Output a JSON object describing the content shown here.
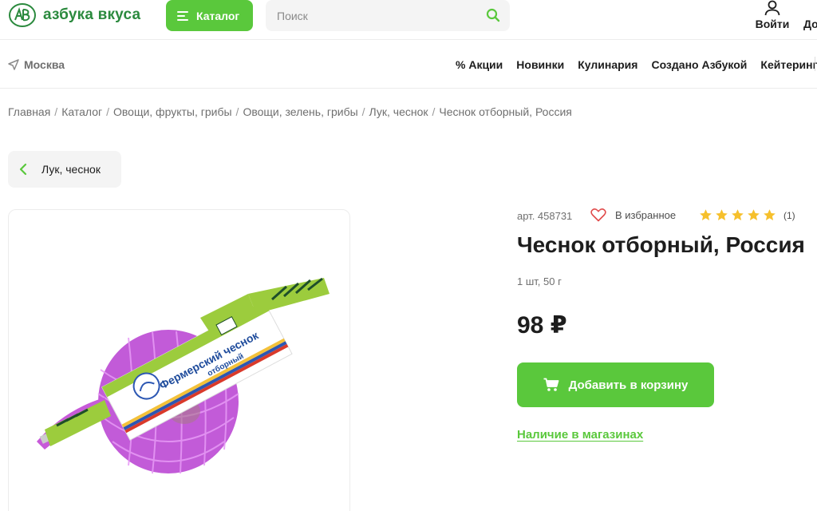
{
  "header": {
    "logo_text": "азбука вкуса",
    "catalog_label": "Каталог",
    "search_placeholder": "Поиск",
    "login_label": "Войти",
    "delivery_cut": "До"
  },
  "subnav": {
    "city": "Москва",
    "menu": [
      "% Акции",
      "Новинки",
      "Кулинария",
      "Создано Азбукой",
      "Кейтеринг"
    ]
  },
  "breadcrumbs": [
    "Главная",
    "Каталог",
    "Овощи, фрукты, грибы",
    "Овощи, зелень, грибы",
    "Лук, чеснок",
    "Чеснок отборный, Россия"
  ],
  "back_label": "Лук, чеснок",
  "product": {
    "article": "арт. 458731",
    "favorite_label": "В избранное",
    "rating": 5,
    "reviews_count": "(1)",
    "title": "Чеснок отборный, Россия",
    "weight": "1 шт, 50 г",
    "price": "98 ₽",
    "add_to_cart": "Добавить в корзину",
    "availability": "Наличие в магазинах",
    "package_label_line1": "Фермерский чеснок",
    "package_label_line2": "отборный"
  },
  "colors": {
    "brand_green": "#5ac83c",
    "star": "#f6c02c",
    "heart": "#e04b4b"
  }
}
